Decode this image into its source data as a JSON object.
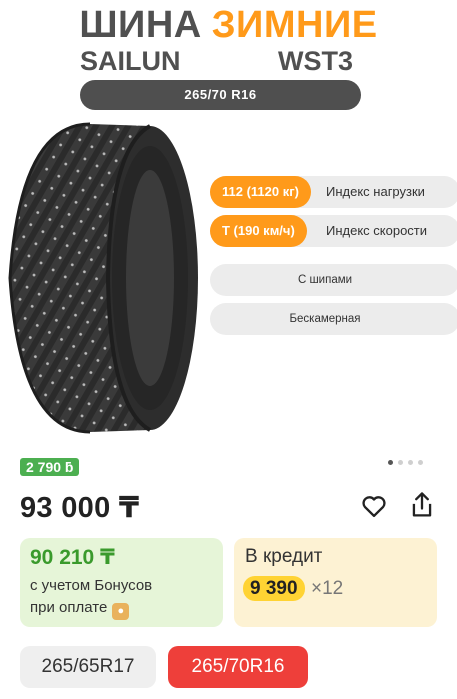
{
  "header": {
    "title_word1": "ШИНА",
    "title_word2": "ЗИМНИЕ",
    "brand": "SAILUN",
    "model": "WST3",
    "size_label": "265/70 R16"
  },
  "features": [
    {
      "value": "112 (1120 кг)",
      "label": "Индекс нагрузки"
    },
    {
      "value": "T (190 км/ч)",
      "label": "Индекс скорости"
    },
    {
      "label": "С шипами"
    },
    {
      "label": "Бескамерная"
    }
  ],
  "gallery": {
    "dots": 4,
    "active_index": 0
  },
  "bonus_badge": "2 790 ƃ",
  "price": "93 000 ₸",
  "bonus_card": {
    "amount": "90 210 ₸",
    "line1": "с учетом Бонусов",
    "line2": "при оплате"
  },
  "credit_card": {
    "title": "В кредит",
    "monthly": "9 390",
    "months": "×12"
  },
  "size_options": [
    {
      "label": "265/65R17",
      "selected": false
    },
    {
      "label": "265/70R16",
      "selected": true
    }
  ],
  "colors": {
    "accent": "#ff9a1a",
    "dark": "#4f4f4f",
    "green": "#3a9a2c",
    "red": "#ee3f3a",
    "yellow": "#ffd333"
  },
  "icons": [
    "heart-icon",
    "share-icon",
    "coin-icon"
  ]
}
